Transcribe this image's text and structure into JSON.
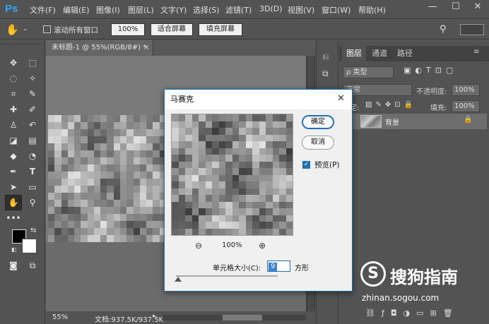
{
  "app": {
    "logo": "Ps"
  },
  "menubar": {
    "items": [
      "文件(F)",
      "编辑(E)",
      "图像(I)",
      "图层(L)",
      "文字(Y)",
      "选择(S)",
      "滤镜(T)",
      "3D(D)",
      "视图(V)",
      "窗口(W)",
      "帮助(H)"
    ]
  },
  "options": {
    "scroll_all_label": "滚动所有窗口",
    "zoom_btn": "100%",
    "fit_btn": "适合屏幕",
    "fill_btn": "填充屏幕"
  },
  "document": {
    "tab_title": "未标题-1 @ 55%(RGB/8#) *",
    "zoom": "55%",
    "doc_info": "文档:937.5K/937.5K"
  },
  "panel": {
    "tabs": [
      "图层",
      "通道",
      "路径"
    ],
    "kind_label": "ρ 类型",
    "blend_mode": "正常",
    "opacity_label": "不透明度:",
    "opacity_value": "100%",
    "lock_label": "锁定:",
    "fill_label": "填充:",
    "fill_value": "100%",
    "layer_name": "背景"
  },
  "dialog": {
    "title": "马赛克",
    "ok": "确定",
    "cancel": "取消",
    "preview_label": "预览(P)",
    "preview_checked": true,
    "zoom_value": "100%",
    "cell_size_label": "单元格大小(C):",
    "cell_size_value": "9",
    "cell_unit": "方形"
  },
  "watermark": {
    "brand": "搜狗指南",
    "url": "zhinan.sogou.com"
  },
  "icons": [
    "hand-icon",
    "move-icon",
    "marquee-icon",
    "lasso-icon",
    "magic-wand-icon",
    "crop-icon",
    "eyedropper-icon",
    "healing-brush-icon",
    "brush-icon",
    "stamp-icon",
    "history-brush-icon",
    "eraser-icon",
    "gradient-icon",
    "blur-icon",
    "dodge-icon",
    "pen-icon",
    "text-icon",
    "path-select-icon",
    "rectangle-icon",
    "zoom-icon",
    "search-icon",
    "zoom-out-icon",
    "zoom-in-icon",
    "close-icon",
    "lock-icon"
  ],
  "colors": {
    "foreground": "#000000",
    "background": "#ffffff",
    "accent": "#1f6fb2"
  }
}
